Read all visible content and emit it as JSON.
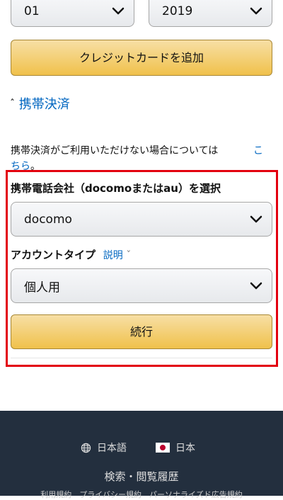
{
  "expiry": {
    "month": "01",
    "year": "2019"
  },
  "add_card_button": "クレジットカードを追加",
  "carrier_section": {
    "caret": "ˆ",
    "title": "携帯決済",
    "notice_text": "携帯決済がご利用いただけない場合については",
    "notice_link_1": "こ",
    "notice_link_2": "ちら",
    "notice_period": "。"
  },
  "carrier_form": {
    "carrier_label": "携帯電話会社（docomoまたはau）を選択",
    "carrier_value": "docomo",
    "account_type_label": "アカウントタイプ",
    "help_link": "説明",
    "help_chevron": "ˇ",
    "account_type_value": "個人用",
    "continue_button": "続行",
    "highlight_color": "#e3000f"
  },
  "footer": {
    "language": "日本語",
    "country": "日本",
    "history_link": "検索・閲覧履歴",
    "bottom_links": "利用規約　プライバシー規約　パーソナライズド広告規約"
  }
}
